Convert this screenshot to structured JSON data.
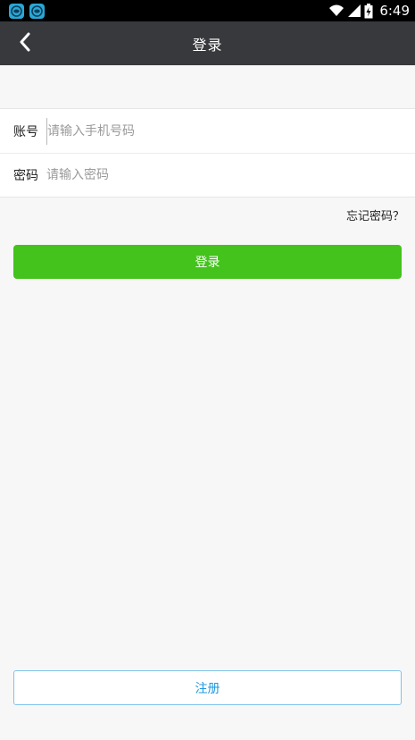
{
  "status_bar": {
    "time": "6:49",
    "left_icons": [
      "app-notification-icon",
      "app-notification-icon"
    ],
    "right_icons": [
      "wifi-icon",
      "signal-icon",
      "battery-charging-icon"
    ]
  },
  "navbar": {
    "title": "登录",
    "back_icon": "chevron-left-icon"
  },
  "form": {
    "account": {
      "label": "账号",
      "placeholder": "请输入手机号码",
      "value": ""
    },
    "password": {
      "label": "密码",
      "placeholder": "请输入密码",
      "value": ""
    }
  },
  "forgot_password": "忘记密码？",
  "login_button": "登录",
  "register_button": "注册",
  "colors": {
    "navbar_bg": "#38393c",
    "primary_green": "#43c31c",
    "link_blue": "#1e9ae0",
    "page_bg": "#f7f7f7"
  }
}
